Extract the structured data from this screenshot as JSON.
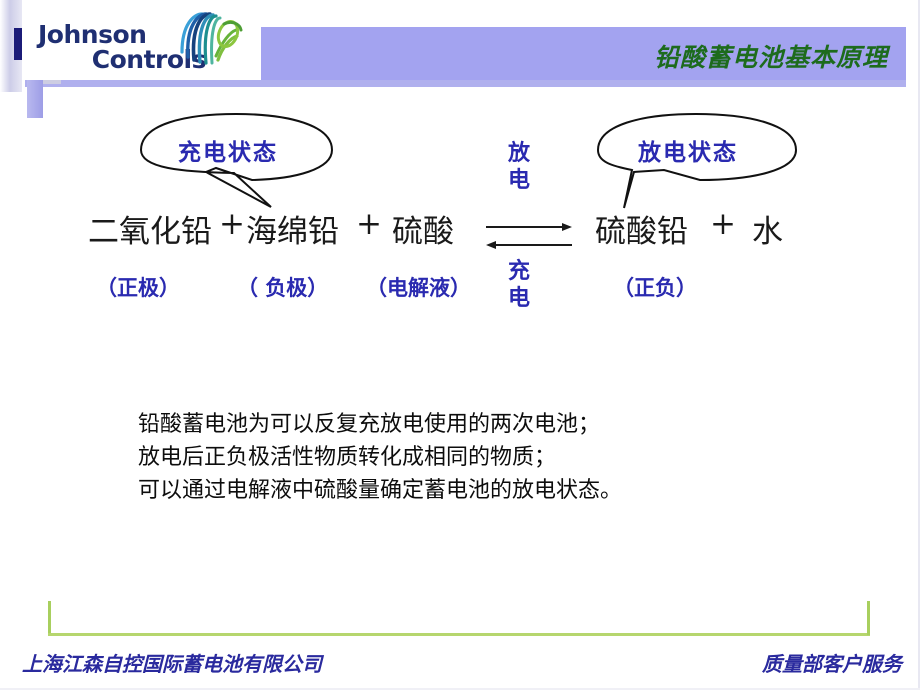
{
  "header": {
    "logo": {
      "line1": "Johnson",
      "line2": "Controls",
      "globe_icon": "globe-arcs-icon"
    },
    "title": "铅酸蓄电池基本原理",
    "title_color": "#1d6b1d",
    "band_color": "#a3a3f0"
  },
  "callouts": [
    {
      "id": "charged",
      "label": "充电状态",
      "color": "#2a2ab0"
    },
    {
      "id": "discharged",
      "label": "放电状态",
      "color": "#2a2ab0"
    }
  ],
  "equation": {
    "left_terms": [
      {
        "text": "二氧化铅",
        "sub": "（正极）"
      },
      {
        "text": "海绵铅",
        "sub": "（ 负极）"
      },
      {
        "text": "硫酸",
        "sub": "（电解液）"
      }
    ],
    "plus": "+",
    "arrows": {
      "top_label": "放\n电",
      "bottom_label": "充\n电",
      "forward": "→",
      "reverse": "←"
    },
    "right_terms": [
      {
        "text": "硫酸铅",
        "sub": "（正负）"
      },
      {
        "text": "水",
        "sub": ""
      }
    ],
    "sub_color": "#2a2ab0"
  },
  "body": {
    "lines": [
      "铅酸蓄电池为可以反复充放电使用的两次电池；",
      "放电后正负极活性物质转化成相同的物质；",
      "可以通过电解液中硫酸量确定蓄电池的放电状态。"
    ]
  },
  "footer": {
    "left": "上海江森自控国际蓄电池有限公司",
    "right": "质量部客户服务",
    "rule_color": "#b6d66e",
    "text_color": "#2a2a9e"
  }
}
